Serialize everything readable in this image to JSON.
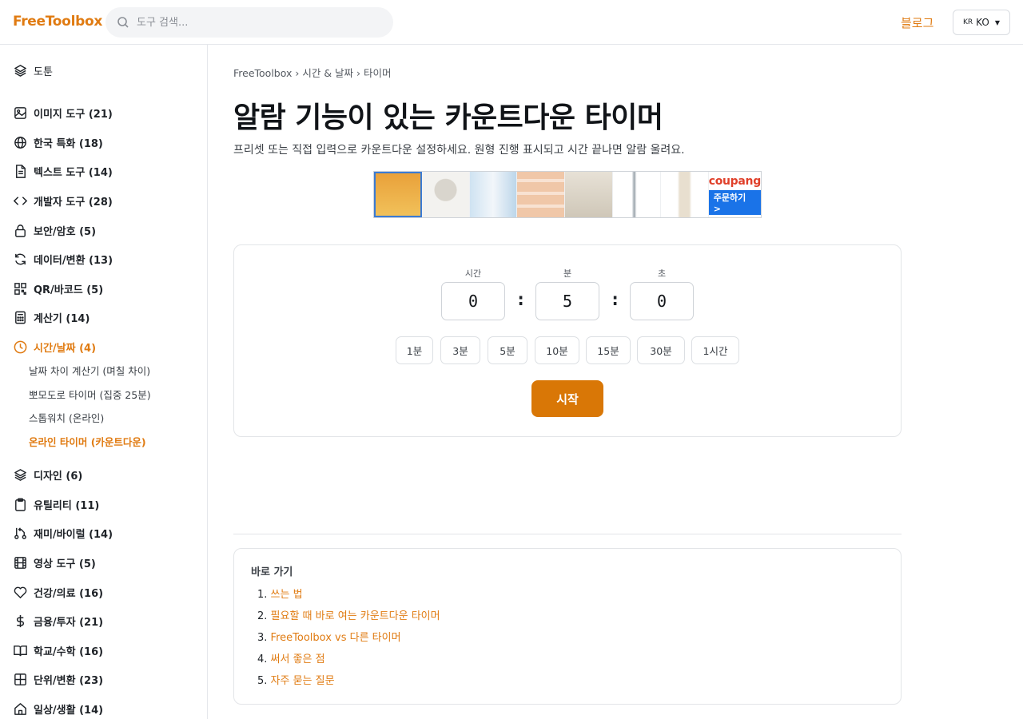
{
  "header": {
    "logo": "FreeToolbox",
    "search_placeholder": "도구 검색...",
    "blog_label": "블로그",
    "lang_flag": "KR",
    "lang_label": "KO"
  },
  "sidebar": {
    "top_item": {
      "label": "도툰",
      "icon": "layers-icon"
    },
    "categories": [
      {
        "label": "이미지 도구 (21)",
        "icon": "image-icon"
      },
      {
        "label": "한국 특화 (18)",
        "icon": "globe-icon"
      },
      {
        "label": "텍스트 도구 (14)",
        "icon": "document-icon"
      },
      {
        "label": "개발자 도구 (28)",
        "icon": "code-icon"
      },
      {
        "label": "보안/암호 (5)",
        "icon": "lock-icon"
      },
      {
        "label": "데이터/변환 (13)",
        "icon": "refresh-icon"
      },
      {
        "label": "QR/바코드 (5)",
        "icon": "qr-icon"
      },
      {
        "label": "계산기 (14)",
        "icon": "calculator-icon"
      },
      {
        "label": "시간/날짜 (4)",
        "icon": "clock-icon",
        "active": true
      },
      {
        "label": "디자인 (6)",
        "icon": "layers-icon"
      },
      {
        "label": "유틸리티 (11)",
        "icon": "clipboard-icon"
      },
      {
        "label": "재미/바이럴 (14)",
        "icon": "fork-icon"
      },
      {
        "label": "영상 도구 (5)",
        "icon": "film-icon"
      },
      {
        "label": "건강/의료 (16)",
        "icon": "heart-icon"
      },
      {
        "label": "금융/투자 (21)",
        "icon": "dollar-icon"
      },
      {
        "label": "학교/수학 (16)",
        "icon": "book-icon"
      },
      {
        "label": "단위/변환 (23)",
        "icon": "grid-icon"
      },
      {
        "label": "일상/생활 (14)",
        "icon": "home-icon"
      }
    ],
    "sub_items": [
      {
        "label": "날짜 차이 계산기 (며칠 차이)"
      },
      {
        "label": "뽀모도로 타이머 (집중 25분)"
      },
      {
        "label": "스톱워치 (온라인)"
      },
      {
        "label": "온라인 타이머 (카운트다운)",
        "active": true
      }
    ]
  },
  "main": {
    "breadcrumb": "FreeToolbox › 시간 & 날짜 › 타이머",
    "title": "알람 기능이 있는 카운트다운 타이머",
    "description": "프리셋 또는 직접 입력으로 카운트다운 설정하세요. 원형 진행 표시되고 시간 끝나면 알람 울려요."
  },
  "ad": {
    "brand": "coupang",
    "button": "주문하기 >"
  },
  "timer": {
    "hours_label": "시간",
    "minutes_label": "분",
    "seconds_label": "초",
    "hours": "0",
    "minutes": "5",
    "seconds": "0",
    "colon": ":",
    "presets": [
      "1분",
      "3분",
      "5분",
      "10분",
      "15분",
      "30분",
      "1시간"
    ],
    "start_label": "시작"
  },
  "toc": {
    "title": "바로 가기",
    "items": [
      {
        "num": "1.",
        "label": "쓰는 법"
      },
      {
        "num": "2.",
        "label": "필요할 때 바로 여는 카운트다운 타이머"
      },
      {
        "num": "3.",
        "label": "FreeToolbox vs 다른 타이머"
      },
      {
        "num": "4.",
        "label": "써서 좋은 점"
      },
      {
        "num": "5.",
        "label": "자주 묻는 질문"
      }
    ]
  },
  "colors": {
    "accent": "#e07b12",
    "start_button": "#d97706",
    "border": "#e3e5e8"
  }
}
